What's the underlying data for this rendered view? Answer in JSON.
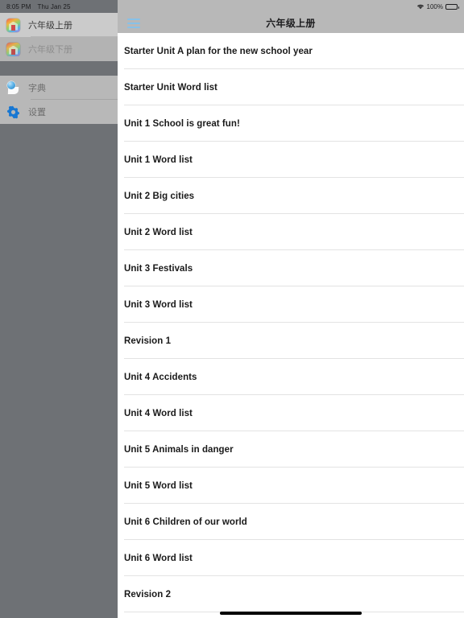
{
  "status_bar": {
    "time": "8:05 PM",
    "date": "Thu Jan 25",
    "battery_percent": "100%",
    "wifi_icon": "wifi-icon",
    "battery_icon": "battery-icon"
  },
  "sidebar": {
    "books": [
      {
        "label": "六年级上册",
        "icon": "book-cover-icon",
        "selected": true
      },
      {
        "label": "六年级下册",
        "icon": "book-cover-icon",
        "selected": false
      }
    ],
    "tools": [
      {
        "label": "字典",
        "icon": "dictionary-globe-icon"
      },
      {
        "label": "设置",
        "icon": "gear-icon"
      }
    ]
  },
  "navbar": {
    "menu_icon": "hamburger-menu-icon",
    "title": "六年级上册"
  },
  "list": {
    "items": [
      "Starter Unit A plan for the new school year",
      "Starter Unit Word list",
      "Unit 1 School is great fun!",
      "Unit 1 Word list",
      "Unit 2 Big cities",
      "Unit 2 Word list",
      "Unit 3 Festivals",
      "Unit 3 Word list",
      "Revision 1",
      "Unit 4 Accidents",
      "Unit 4 Word list",
      "Unit 5 Animals in danger",
      "Unit 5 Word list",
      "Unit 6 Children of our world",
      "Unit 6 Word list",
      "Revision 2"
    ]
  },
  "colors": {
    "sidebar_bg": "#6e7175",
    "sidebar_group_bg": "#b8b8b8",
    "sidebar_selected_bg": "#cbcbcb",
    "navbar_bg": "#b8b8b8",
    "accent": "#87c1e8",
    "content_bg": "#ffffff",
    "separator": "#e3e3e3"
  }
}
